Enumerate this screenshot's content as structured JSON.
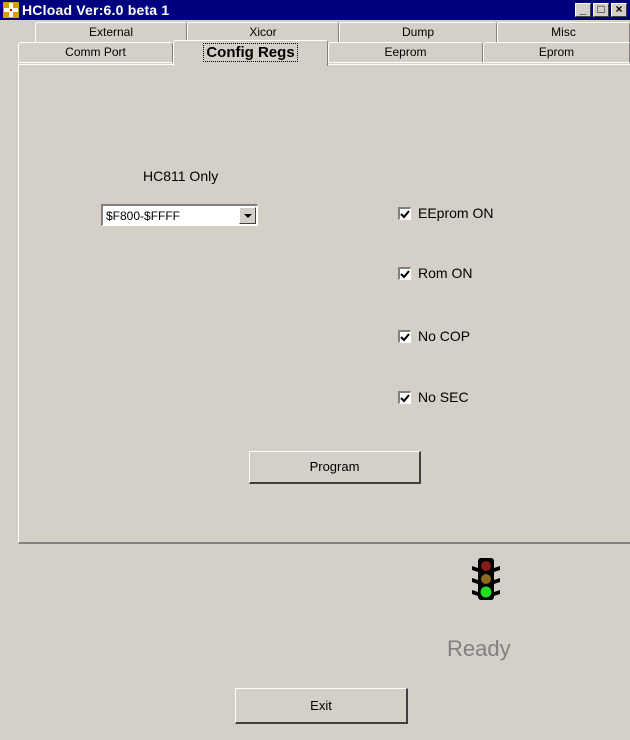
{
  "window": {
    "title": "HCload Ver:6.0 beta 1",
    "titlebar_color": "#00007f",
    "buttons": [
      {
        "name": "minimize-button",
        "glyph": "_"
      },
      {
        "name": "maximize-button",
        "glyph": "□"
      },
      {
        "name": "close-button",
        "glyph": "×"
      }
    ]
  },
  "tabs": {
    "row1": [
      "External",
      "Xicor",
      "Dump",
      "Misc"
    ],
    "row2": [
      "Comm Port",
      "Config Regs",
      "Eeprom",
      "Eprom"
    ],
    "active": "Config Regs"
  },
  "config": {
    "hc811_label": "HC811 Only",
    "address_range": "$F800-$FFFF",
    "checkboxes": [
      {
        "label": "EEprom ON",
        "checked": true
      },
      {
        "label": "Rom ON",
        "checked": true
      },
      {
        "label": "No COP",
        "checked": true
      },
      {
        "label": "No SEC",
        "checked": true
      }
    ],
    "program_label": "Program"
  },
  "status": {
    "text": "Ready",
    "light": "green"
  },
  "exit_label": "Exit"
}
